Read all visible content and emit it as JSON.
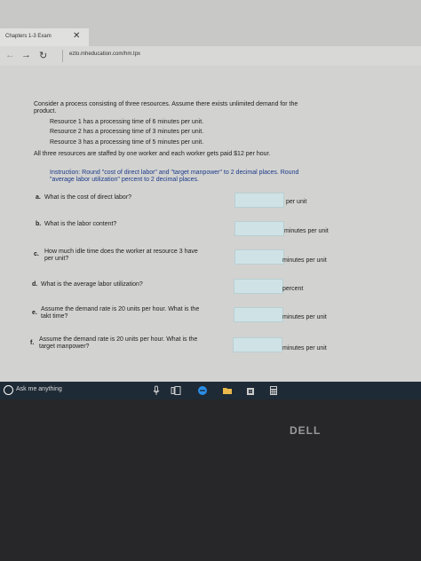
{
  "browser": {
    "tab_title": "Chapters 1-3 Exam",
    "tab_close": "✕",
    "url": "ezto.mheducation.com/hm.tpx"
  },
  "problem": {
    "intro_line1": "Consider a process consisting of three resources. Assume there exists unlimited demand for the",
    "intro_line2": "product.",
    "resources": [
      "Resource 1 has a processing time of 6 minutes per unit.",
      "Resource 2 has a processing time of 3 minutes per unit.",
      "Resource 3 has a processing time of 5 minutes per unit."
    ],
    "staffing": "All three resources are staffed by one worker and each worker gets paid $12 per hour.",
    "instruction_line1": "Instruction: Round \"cost of direct labor\" and \"target manpower\" to 2 decimal places. Round",
    "instruction_line2": "\"average labor utilization\" percent to 2 decimal places."
  },
  "questions": [
    {
      "letter": "a.",
      "line1": "What is the cost of direct labor?",
      "line2": "",
      "unit": "per unit"
    },
    {
      "letter": "b.",
      "line1": "What is the labor content?",
      "line2": "",
      "unit": "minutes per unit"
    },
    {
      "letter": "c.",
      "line1": "How much idle time does the worker at resource 3 have",
      "line2": "per unit?",
      "unit": "minutes per unit"
    },
    {
      "letter": "d.",
      "line1": "What is the average labor utilization?",
      "line2": "",
      "unit": "percent"
    },
    {
      "letter": "e.",
      "line1": "Assume the demand rate is 20 units per hour. What is the",
      "line2": "takt time?",
      "unit": "minutes per unit"
    },
    {
      "letter": "f.",
      "line1": "Assume the demand rate is 20 units per hour. What is the",
      "line2": "target manpower?",
      "unit": "minutes per unit"
    }
  ],
  "taskbar": {
    "search_placeholder": "Ask me anything"
  },
  "device": {
    "logo": "DELL"
  },
  "colors": {
    "taskbar": "#1e2a36",
    "answer_box": "#cfe3e6",
    "instruction_text": "#1a3a8a"
  }
}
